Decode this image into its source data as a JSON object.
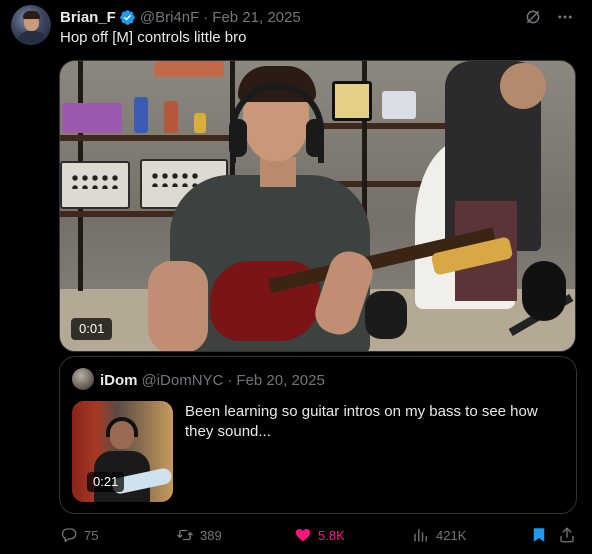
{
  "author": {
    "name": "Brian_F",
    "handle": "@Bri4nF",
    "separator": "·",
    "date": "Feb 21, 2025"
  },
  "tweet": {
    "text": "Hop off [M] controls little bro"
  },
  "video": {
    "timestamp": "0:01"
  },
  "quoted": {
    "name": "iDom",
    "handle": "@iDomNYC",
    "separator": "·",
    "date": "Feb 20, 2025",
    "text": "Been learning so guitar intros on my bass to see how they sound...",
    "video_timestamp": "0:21"
  },
  "actions": {
    "replies": "75",
    "reposts": "389",
    "likes": "5.8K",
    "views": "421K"
  },
  "colors": {
    "background": "#000000",
    "text": "#e7e9ea",
    "muted": "#71767b",
    "border": "#2f3336",
    "verified": "#1d9bf0",
    "like": "#f91880",
    "bookmark": "#1d9bf0"
  },
  "icons": {
    "verified": "verified-badge-icon",
    "grok": "grok-icon",
    "more": "more-icon",
    "reply": "reply-icon",
    "repost": "repost-icon",
    "like": "heart-filled-icon",
    "views": "views-icon",
    "bookmark": "bookmark-filled-icon",
    "share": "share-icon"
  }
}
